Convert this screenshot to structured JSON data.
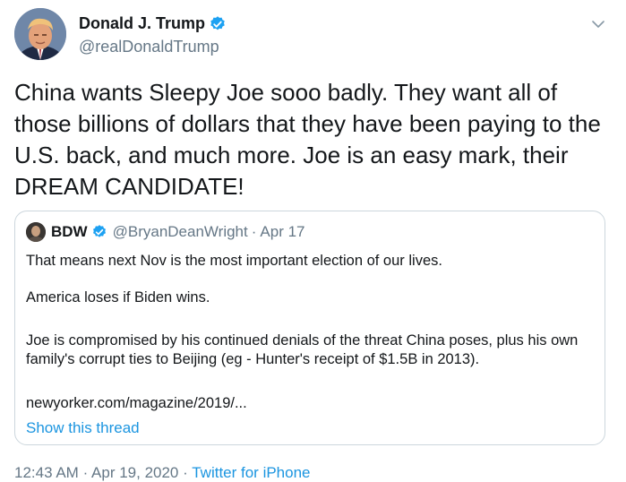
{
  "author": {
    "display_name": "Donald J. Trump",
    "handle": "@realDonaldTrump",
    "verified_icon": "verified-badge-icon"
  },
  "tweet": {
    "text": "China wants Sleepy Joe sooo badly. They want all of those billions of dollars that they have been paying to the U.S. back, and much more. Joe is an easy mark, their DREAM CANDIDATE!"
  },
  "quote": {
    "display_name": "BDW",
    "handle": "@BryanDeanWright",
    "separator": "·",
    "date": "Apr 17",
    "paragraphs": [
      "That means next Nov is the most important election of our lives.",
      "America loses if Biden wins.",
      "Joe is compromised by his continued denials of the threat China poses, plus his own family's corrupt ties to Beijing (eg - Hunter's receipt of $1.5B in 2013).",
      "newyorker.com/magazine/2019/..."
    ],
    "show_thread": "Show this thread"
  },
  "meta": {
    "time": "12:43 AM",
    "separator1": "·",
    "date": "Apr 19, 2020",
    "separator2": "·",
    "source": "Twitter for iPhone"
  },
  "colors": {
    "accent": "#1b95e0",
    "verified": "#1da1f2",
    "secondary_text": "#657786",
    "border": "#ccd6dd"
  }
}
